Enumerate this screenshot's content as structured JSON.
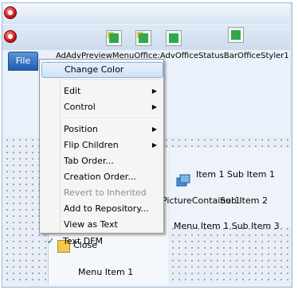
{
  "form": {
    "component_path": "AdAdvPreviewMenuOffice:AdvOfficeStatusBarOfficeStyler1",
    "file_button_label": "File"
  },
  "context_menu": {
    "items": [
      {
        "label": "Change Color",
        "highlighted": true
      },
      {
        "label": "Edit",
        "submenu": true
      },
      {
        "label": "Control",
        "submenu": true
      },
      {
        "label": "Position",
        "submenu": true
      },
      {
        "label": "Flip Children",
        "submenu": true
      },
      {
        "label": "Tab Order..."
      },
      {
        "label": "Creation Order..."
      },
      {
        "label": "Revert to Inherited",
        "disabled": true
      },
      {
        "label": "Add to Repository..."
      },
      {
        "label": "View as Text"
      },
      {
        "label": "Text DFM",
        "checked": true
      }
    ],
    "submenu_arrow": "▶",
    "check_mark": "✓"
  },
  "panel": {
    "close_label": "Close",
    "menu_item_label": "Menu Item 1",
    "picture_container_label": "PictureContainer1",
    "sub_items": [
      "Item 1 Sub Item 1",
      "Sub Item 2",
      "Menu Item 1 Sub Item 3"
    ]
  },
  "icons": [
    "app-orb-icon",
    "ribbon-picture-icon",
    "ribbon-green-icon",
    "picture-container-icon"
  ],
  "colors": {
    "accent": "#1f5cb0",
    "menu_highlight": "#cfe2f6",
    "form_background": "#dbe7f5"
  }
}
